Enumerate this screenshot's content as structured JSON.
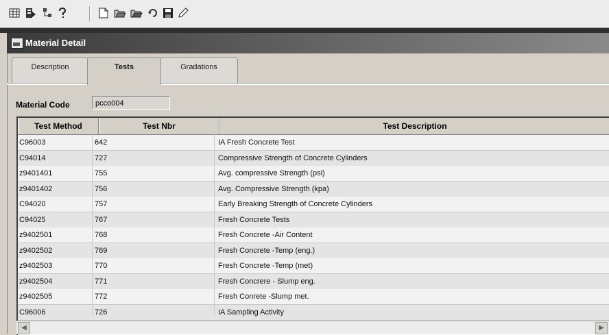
{
  "toolbar": {
    "icons": [
      "grid-icon",
      "report-icon",
      "tree-icon",
      "help-icon",
      "new-icon",
      "open-icon",
      "open-folder-icon",
      "refresh-icon",
      "save-icon",
      "edit-icon"
    ]
  },
  "window": {
    "title": "Material Detail"
  },
  "tabs": [
    {
      "label": "Description"
    },
    {
      "label": "Tests"
    },
    {
      "label": "Gradations"
    }
  ],
  "form": {
    "material_code_label": "Material Code",
    "material_code_value": "pcco004"
  },
  "grid": {
    "columns": [
      "Test Method",
      "Test Nbr",
      "Test Description"
    ],
    "rows": [
      [
        "C96003",
        "642",
        "IA Fresh Concrete Test"
      ],
      [
        "C94014",
        "727",
        "Compressive Strength of Concrete Cylinders"
      ],
      [
        "z9401401",
        "755",
        "Avg. compressive Strength (psi)"
      ],
      [
        "z9401402",
        "756",
        "Avg. Compressive Strength (kpa)"
      ],
      [
        "C94020",
        "757",
        "Early Breaking Strength of Concrete Cylinders"
      ],
      [
        "C94025",
        "767",
        "Fresh Concrete Tests"
      ],
      [
        "z9402501",
        "768",
        "Fresh Concrete -Air Content"
      ],
      [
        "z9402502",
        "769",
        "Fresh Concrete -Temp (eng.)"
      ],
      [
        "z9402503",
        "770",
        "Fresh Concrete -Temp (met)"
      ],
      [
        "z9402504",
        "771",
        "Fresh Concrere - Slump eng."
      ],
      [
        "z9402505",
        "772",
        "Fresh Conrete -Slump met."
      ],
      [
        "C96006",
        "726",
        "IA Sampling Activity"
      ]
    ]
  }
}
